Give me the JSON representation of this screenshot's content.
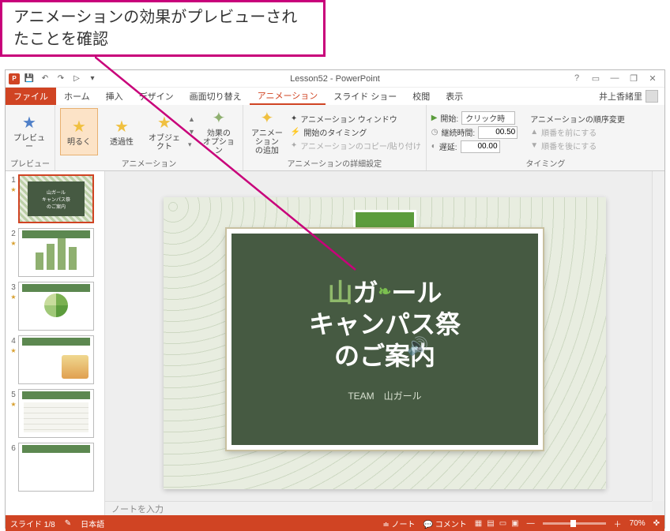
{
  "callout": {
    "text": "アニメーションの効果がプレビューされたことを確認"
  },
  "window": {
    "title": "Lesson52 - PowerPoint",
    "user": "井上香緒里",
    "controls": {
      "help": "?",
      "ribbon_opt": "▭",
      "min": "—",
      "restore": "❐",
      "close": "✕"
    }
  },
  "qat": {
    "save": "💾",
    "undo": "↶",
    "redo": "↷",
    "start": "▷",
    "more": "▾"
  },
  "tabs": {
    "file": "ファイル",
    "home": "ホーム",
    "insert": "挿入",
    "design": "デザイン",
    "transitions": "画面切り替え",
    "animations": "アニメーション",
    "slideshow": "スライド ショー",
    "review": "校閲",
    "view": "表示"
  },
  "ribbon": {
    "preview": {
      "btn": "プレビュー",
      "group": "プレビュー"
    },
    "animation": {
      "brighten": "明るく",
      "transparency": "透過性",
      "object": "オブジェクト",
      "effect_options": "効果の\nオプション",
      "group": "アニメーション"
    },
    "advanced": {
      "add": "アニメーション\nの追加",
      "pane": "アニメーション ウィンドウ",
      "trigger": "開始のタイミング",
      "painter": "アニメーションのコピー/貼り付け",
      "group": "アニメーションの詳細設定"
    },
    "timing": {
      "start_label": "開始:",
      "start_value": "クリック時",
      "duration_label": "継続時間:",
      "duration_value": "00.50",
      "delay_label": "遅延:",
      "delay_value": "00.00",
      "reorder": "アニメーションの順序変更",
      "earlier": "順番を前にする",
      "later": "順番を後にする",
      "group": "タイミング"
    }
  },
  "thumbnails": [
    1,
    2,
    3,
    4,
    5,
    6
  ],
  "slide": {
    "title_line1_a": "山",
    "title_line1_b": "ガ",
    "title_line1_c": "ール",
    "title_line2": "キャンパス祭",
    "title_line3": "のご案内",
    "team": "TEAM　山ガール"
  },
  "notes_placeholder": "ノートを入力",
  "statusbar": {
    "slide": "スライド 1/8",
    "lang": "日本語",
    "notes": "ノート",
    "comments": "コメント",
    "zoom": "70%",
    "fit": "✜"
  }
}
